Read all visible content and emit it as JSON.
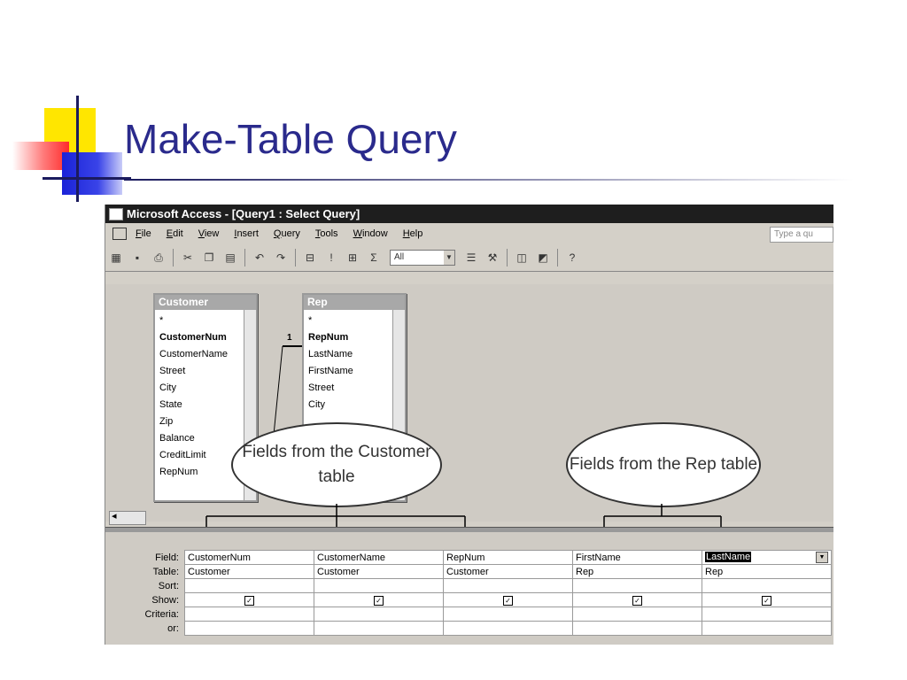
{
  "slide": {
    "title": "Make-Table Query"
  },
  "window": {
    "title": "Microsoft Access - [Query1 : Select Query]"
  },
  "menu": {
    "items": [
      "File",
      "Edit",
      "View",
      "Insert",
      "Query",
      "Tools",
      "Window",
      "Help"
    ],
    "ask_placeholder": "Type a qu"
  },
  "toolbar": {
    "totals_combo": "All"
  },
  "tables": {
    "customer": {
      "title": "Customer",
      "fields": [
        "*",
        "CustomerNum",
        "CustomerName",
        "Street",
        "City",
        "State",
        "Zip",
        "Balance",
        "CreditLimit",
        "RepNum"
      ],
      "primary_key": "CustomerNum"
    },
    "rep": {
      "title": "Rep",
      "fields": [
        "*",
        "RepNum",
        "LastName",
        "FirstName",
        "Street",
        "City"
      ],
      "primary_key": "RepNum"
    },
    "relationship_label": "1"
  },
  "callouts": {
    "customer": "Fields from the Customer table",
    "rep": "Fields from the Rep table"
  },
  "grid": {
    "row_labels": [
      "Field:",
      "Table:",
      "Sort:",
      "Show:",
      "Criteria:",
      "or:"
    ],
    "columns": [
      {
        "field": "CustomerNum",
        "table": "Customer",
        "show": true
      },
      {
        "field": "CustomerName",
        "table": "Customer",
        "show": true
      },
      {
        "field": "RepNum",
        "table": "Customer",
        "show": true
      },
      {
        "field": "FirstName",
        "table": "Rep",
        "show": true
      },
      {
        "field": "LastName",
        "table": "Rep",
        "show": true
      }
    ]
  },
  "icons": [
    "datasheet-view-icon",
    "save-icon",
    "print-icon",
    "cut-icon",
    "copy-icon",
    "paste-icon",
    "undo-icon",
    "run-icon",
    "show-table-icon",
    "totals-icon",
    "help-icon"
  ],
  "colors": {
    "title": "#2a2a8c",
    "titlebar": "#1e1e1e",
    "window_bg": "#d4d0c8"
  }
}
